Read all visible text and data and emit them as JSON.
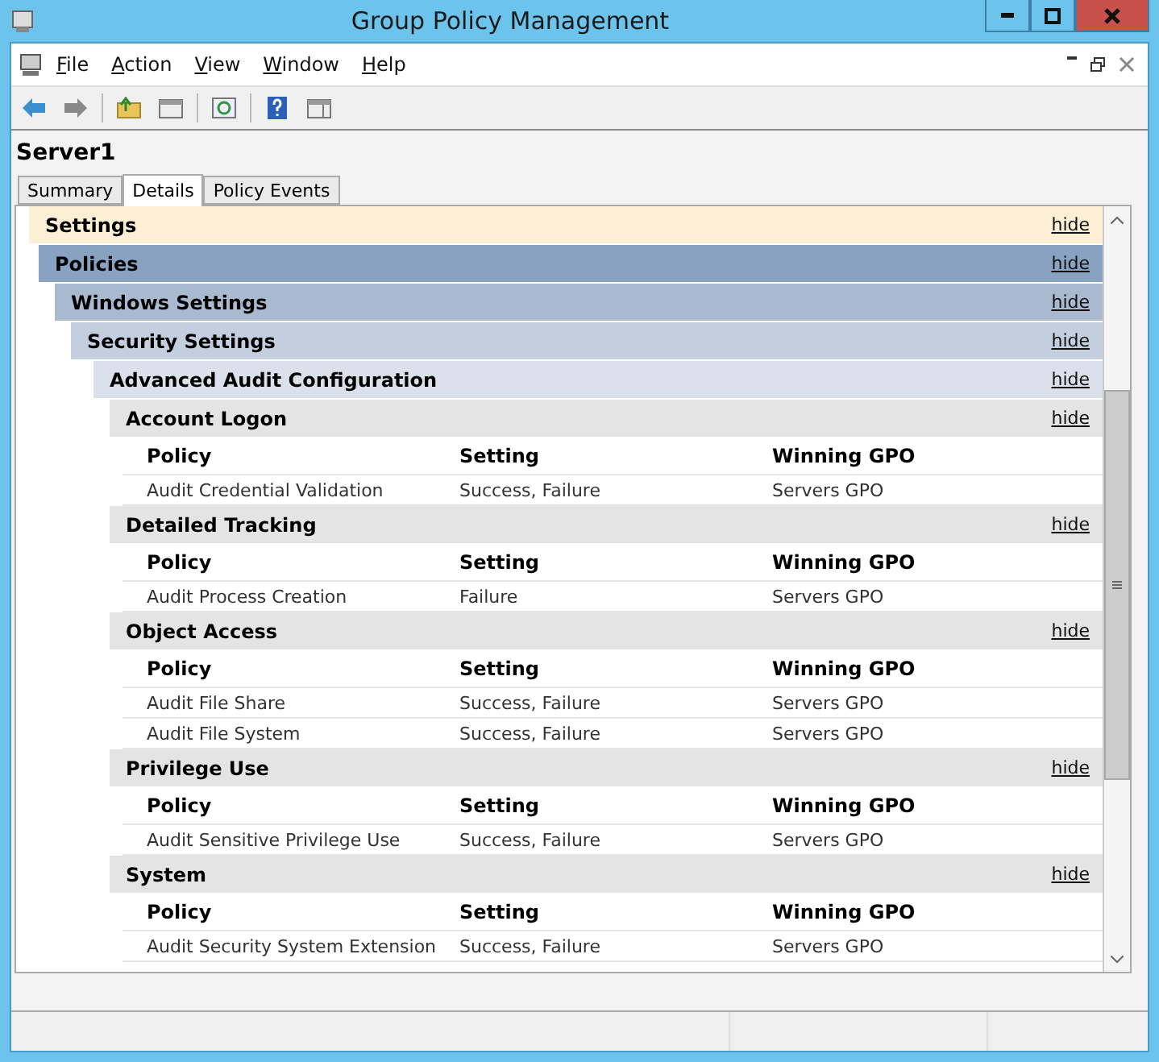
{
  "window": {
    "title": "Group Policy Management"
  },
  "menu": [
    {
      "label": "File"
    },
    {
      "label": "Action"
    },
    {
      "label": "View"
    },
    {
      "label": "Window"
    },
    {
      "label": "Help"
    }
  ],
  "heading": "Server1",
  "tabs": [
    {
      "label": "Summary",
      "selected": false
    },
    {
      "label": "Details",
      "selected": true
    },
    {
      "label": "Policy Events",
      "selected": false
    }
  ],
  "report": {
    "title": "Settings",
    "link": "hide",
    "children": [
      {
        "title": "Policies",
        "link": "hide",
        "children": [
          {
            "title": "Windows Settings",
            "link": "hide",
            "children": [
              {
                "title": "Security Settings",
                "link": "hide",
                "children": [
                  {
                    "title": "Advanced Audit Configuration",
                    "link": "hide",
                    "children": [
                      {
                        "title": "Account Logon",
                        "link": "hide",
                        "table": {
                          "columns": [
                            "Policy",
                            "Setting",
                            "Winning GPO"
                          ],
                          "rows": [
                            [
                              "Audit Credential Validation",
                              "Success, Failure",
                              "Servers GPO"
                            ]
                          ]
                        }
                      },
                      {
                        "title": "Detailed Tracking",
                        "link": "hide",
                        "table": {
                          "columns": [
                            "Policy",
                            "Setting",
                            "Winning GPO"
                          ],
                          "rows": [
                            [
                              "Audit Process Creation",
                              "Failure",
                              "Servers GPO"
                            ]
                          ]
                        }
                      },
                      {
                        "title": "Object Access",
                        "link": "hide",
                        "table": {
                          "columns": [
                            "Policy",
                            "Setting",
                            "Winning GPO"
                          ],
                          "rows": [
                            [
                              "Audit File Share",
                              "Success, Failure",
                              "Servers GPO"
                            ],
                            [
                              "Audit File System",
                              "Success, Failure",
                              "Servers GPO"
                            ]
                          ]
                        }
                      },
                      {
                        "title": "Privilege Use",
                        "link": "hide",
                        "table": {
                          "columns": [
                            "Policy",
                            "Setting",
                            "Winning GPO"
                          ],
                          "rows": [
                            [
                              "Audit Sensitive Privilege Use",
                              "Success, Failure",
                              "Servers GPO"
                            ]
                          ]
                        }
                      },
                      {
                        "title": "System",
                        "link": "hide",
                        "table": {
                          "columns": [
                            "Policy",
                            "Setting",
                            "Winning GPO"
                          ],
                          "rows": [
                            [
                              "Audit Security System Extension",
                              "Success, Failure",
                              "Servers GPO"
                            ]
                          ]
                        }
                      }
                    ]
                  }
                ]
              }
            ]
          }
        ]
      }
    ]
  }
}
